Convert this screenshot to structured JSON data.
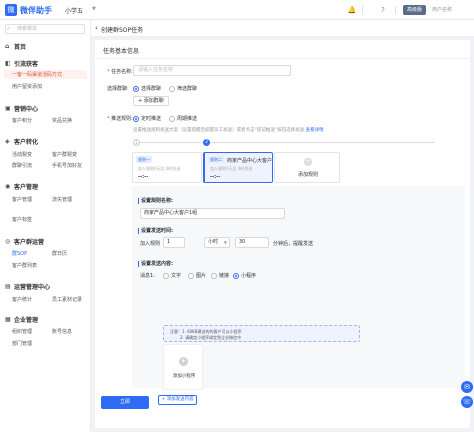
{
  "app": {
    "name": "微伴助手",
    "shop": "小学五"
  },
  "topbar": {
    "vip": "高级版",
    "user": "用户名称"
  },
  "sidebar": {
    "search_placeholder": "搜索菜单",
    "home": "首页",
    "groups": [
      {
        "title": "引流获客",
        "items": [
          "一客一码渠道活码方式",
          "用户留资添加"
        ]
      },
      {
        "title": "营销中心",
        "items": [
          "客户积分",
          "奖品兑换"
        ]
      },
      {
        "title": "客户转化",
        "items": [
          "活动裂变",
          "客户群裂变",
          "群聊引流",
          "手机号加好友"
        ]
      },
      {
        "title": "客户管理",
        "items": [
          "客户管理",
          "流失管理",
          "客户标签"
        ]
      },
      {
        "title": "客户群运营",
        "items": [
          "群SOP",
          "群日历",
          "客户群列表"
        ]
      },
      {
        "title": "运营管理中心",
        "items": [
          "客户统计",
          "员工素材记录"
        ]
      },
      {
        "title": "企业管理",
        "items": [
          "组织管理",
          "账号信息",
          "部门管理"
        ]
      }
    ]
  },
  "header": {
    "title": "创建群SOP任务"
  },
  "form": {
    "section_title": "任务基本信息",
    "task_name_label": "任务名称:",
    "task_name_placeholder": "请输入任务名称",
    "group_label": "选择群聊:",
    "group_options": [
      "选择群聊",
      "筛选群聊"
    ],
    "add_group_btn": "添加群聊",
    "rule_label": "推送规则:",
    "rule_options": [
      "定时推送",
      "周期推送"
    ],
    "rule_hint": "设置推送规则发送文案（设置提醒后提醒员工发送）或者点击“提前推送”按钮选择发送",
    "rule_hint_link": "查看详情",
    "rules": [
      {
        "tag": "规则一",
        "name": "",
        "sub": "加入规则0天后 0时发送",
        "time": "--:--"
      },
      {
        "tag": "规则二",
        "name": "商家产品中心大客户...",
        "sub": "加入规则1天后 0时发送",
        "time": "--:--"
      }
    ],
    "add_rule_label": "添加规则",
    "config": {
      "name_title": "设置规则名称:",
      "name_value": "商家产品中心大客户1组",
      "time_title": "设置发送时间:",
      "join_prefix": "加入规则",
      "days_value": "1",
      "unit_value": "小时",
      "minute_value": "30",
      "time_suffix": "分钟后，提醒发送",
      "content_title": "设置发送内容:",
      "msg_label": "消息1:",
      "content_types": [
        "文字",
        "图片",
        "链接",
        "小程序"
      ],
      "note_lines": [
        "注意：1. 60KB建议的的客户可以小程序",
        "2. 请确定小程序绑定到企业微信中"
      ],
      "mini_add_label": "添加小程序",
      "add_content_btn": "添加发送内容"
    },
    "save_btn": "立即"
  }
}
